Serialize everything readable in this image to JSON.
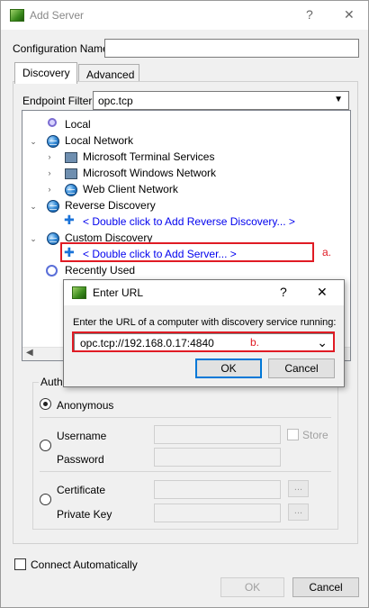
{
  "window": {
    "title": "Add Server",
    "help": "?",
    "close": "✕"
  },
  "config_name": {
    "label": "Configuration Name",
    "value": ""
  },
  "tabs": [
    {
      "label": "Discovery"
    },
    {
      "label": "Advanced"
    }
  ],
  "endpoint_filter": {
    "label": "Endpoint Filter:",
    "value": "opc.tcp"
  },
  "tree": {
    "local": "Local",
    "local_network": "Local Network",
    "ms_terminal": "Microsoft Terminal Services",
    "ms_windows": "Microsoft Windows Network",
    "web_client": "Web Client Network",
    "reverse_discovery": "Reverse Discovery",
    "add_reverse": "< Double click to Add Reverse Discovery... >",
    "custom_discovery": "Custom Discovery",
    "add_server": "< Double click to Add Server... >",
    "recently_used": "Recently Used"
  },
  "auth": {
    "title": "Authe",
    "anonymous": "Anonymous",
    "username": "Username",
    "password": "Password",
    "store": "Store",
    "certificate": "Certificate",
    "private_key": "Private Key",
    "browse": "..."
  },
  "connect_auto": "Connect Automatically",
  "buttons": {
    "ok": "OK",
    "cancel": "Cancel"
  },
  "popup": {
    "title": "Enter URL",
    "help": "?",
    "close": "✕",
    "prompt": "Enter the URL of a computer with discovery service running:",
    "url": "opc.tcp://192.168.0.17:4840",
    "ok": "OK",
    "cancel": "Cancel"
  },
  "annotations": {
    "a": "a.",
    "b": "b."
  },
  "colors": {
    "annotation": "#e01b24",
    "link": "#0000ee",
    "accent": "#0078d7"
  }
}
